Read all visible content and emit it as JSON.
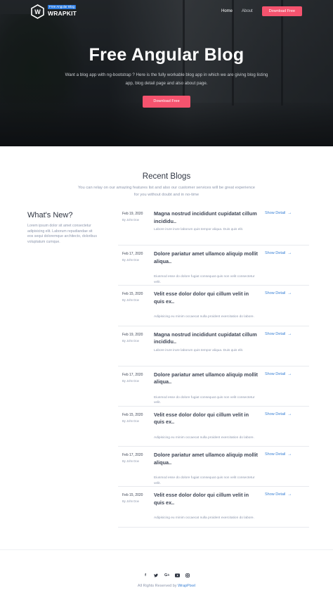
{
  "nav": {
    "logo_badge": "Free Angular Blog",
    "logo_name": "WRAPKIT",
    "home": "Home",
    "about": "About",
    "download": "Download Free"
  },
  "hero": {
    "title": "Free Angular Blog",
    "subtitle": "Want a blog app with ng-bootstrap ? Here is the fully workable blog app in which we are giving blog listing app, blog detail page and also about page.",
    "button": "Download Free"
  },
  "blogs_section": {
    "title": "Recent Blogs",
    "subtitle": "You can relay on our amazing features list and also our customer services will be great experience for you without doubt and in no-time"
  },
  "whats_new": {
    "title": "What's New?",
    "text": "Lorem ipsum dolor sit amet consectetur adipisicing elit. Laborum repudiandae sit eos sequi doloremque architecto, doloribus voluptatum cumque."
  },
  "blogs": [
    {
      "date": "Feb 19, 2020",
      "author": "By John Doe",
      "title": "Magna nostrud incididunt cupidatat cillum incididu..",
      "excerpt": "Labore irure irure laborum quis tempor aliqua. Duis quis elit.",
      "link": "Show Detail"
    },
    {
      "date": "Feb 17, 2020",
      "author": "By John Doe",
      "title": "Dolore pariatur amet ullamco aliquip mollit aliqua..",
      "excerpt": "Eiusmod esse do dolore fugiat consequat quis non velit consectetur velit.",
      "link": "Show Detail"
    },
    {
      "date": "Feb 15, 2020",
      "author": "By John Doe",
      "title": "Velit esse dolor dolor qui cillum velit in quis ex..",
      "excerpt": "Adipisicing eu minim occaecat nulla proident exercitation do labore.",
      "link": "Show Detail"
    },
    {
      "date": "Feb 19, 2020",
      "author": "By John Doe",
      "title": "Magna nostrud incididunt cupidatat cillum incididu..",
      "excerpt": "Labore irure irure laborum quis tempor aliqua. Duis quis elit.",
      "link": "Show Detail"
    },
    {
      "date": "Feb 17, 2020",
      "author": "By John Doe",
      "title": "Dolore pariatur amet ullamco aliquip mollit aliqua..",
      "excerpt": "Eiusmod esse do dolore fugiat consequat quis non velit consectetur velit.",
      "link": "Show Detail"
    },
    {
      "date": "Feb 15, 2020",
      "author": "By John Doe",
      "title": "Velit esse dolor dolor qui cillum velit in quis ex..",
      "excerpt": "Adipisicing eu minim occaecat nulla proident exercitation do labore.",
      "link": "Show Detail"
    },
    {
      "date": "Feb 17, 2020",
      "author": "By John Doe",
      "title": "Dolore pariatur amet ullamco aliquip mollit aliqua..",
      "excerpt": "Eiusmod esse do dolore fugiat consequat quis non velit consectetur velit.",
      "link": "Show Detail"
    },
    {
      "date": "Feb 15, 2020",
      "author": "By John Doe",
      "title": "Velit esse dolor dolor qui cillum velit in quis ex..",
      "excerpt": "Adipisicing eu minim occaecat nulla proident exercitation do labore.",
      "link": "Show Detail"
    }
  ],
  "footer": {
    "social_icons": [
      "facebook-icon",
      "twitter-icon",
      "google-plus-icon",
      "youtube-icon",
      "instagram-icon"
    ],
    "copyright_prefix": "All Rights Reserved by",
    "copyright_brand": "WrapPixel"
  },
  "colors": {
    "accent": "#f5536e",
    "link": "#3b82d6",
    "heading": "#2f3542",
    "muted": "#8d97ad"
  }
}
